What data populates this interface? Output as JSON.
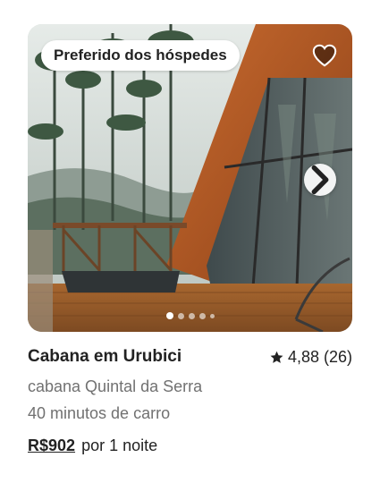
{
  "listing": {
    "badge": "Preferido dos hóspedes",
    "title": "Cabana em Urubici",
    "rating": "4,88 (26)",
    "subtitle": "cabana Quintal da Serra",
    "distance": "40 minutos de carro",
    "price": "R$902",
    "price_suffix": "por 1 noite",
    "photo": {
      "icons": {
        "favorite": "heart-icon",
        "next": "chevron-right-icon",
        "rating": "star-icon"
      },
      "carousel": {
        "dot_count": 5,
        "active_index": 0
      }
    }
  },
  "colors": {
    "text": "#222222",
    "secondary_text": "#717171",
    "wood": "#b8602c"
  }
}
